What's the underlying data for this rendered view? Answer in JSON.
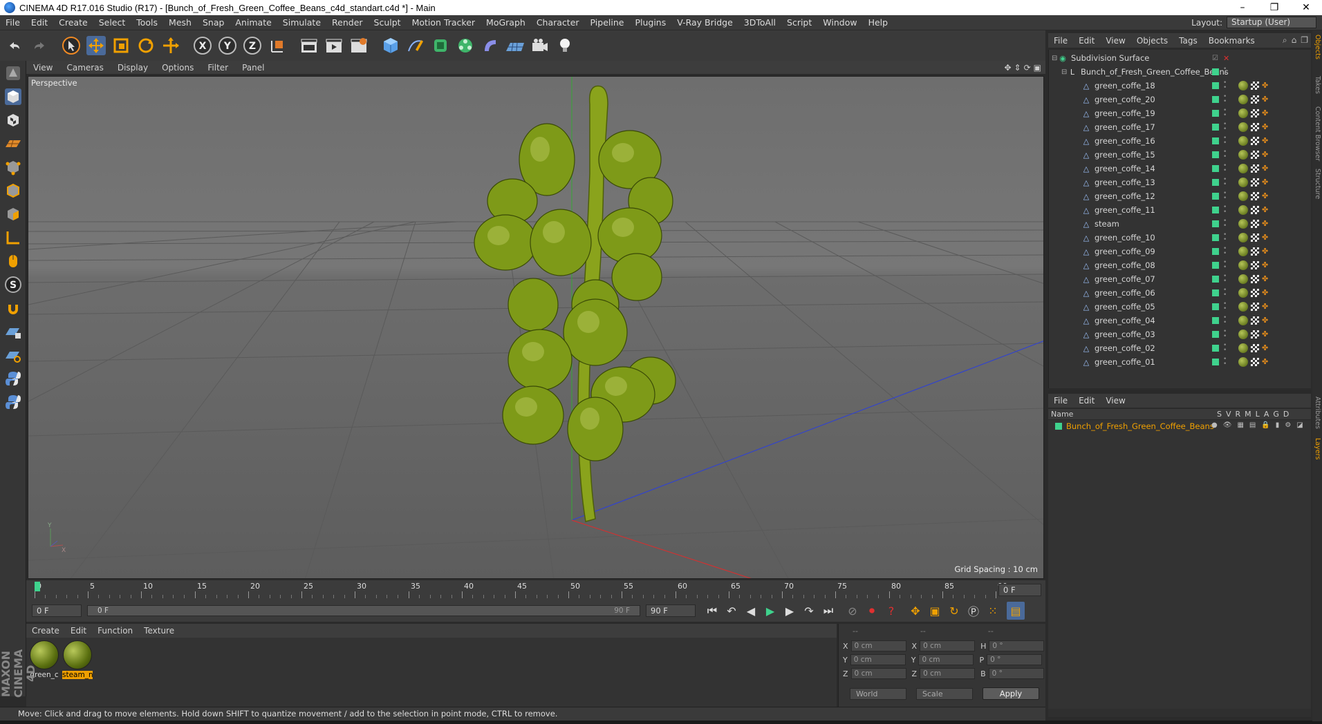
{
  "window": {
    "title": "CINEMA 4D R17.016 Studio (R17) - [Bunch_of_Fresh_Green_Coffee_Beans_c4d_standart.c4d *] - Main",
    "controls": [
      "–",
      "❐",
      "✕"
    ]
  },
  "menubar": {
    "items": [
      "File",
      "Edit",
      "Create",
      "Select",
      "Tools",
      "Mesh",
      "Snap",
      "Animate",
      "Simulate",
      "Render",
      "Sculpt",
      "Motion Tracker",
      "MoGraph",
      "Character",
      "Pipeline",
      "Plugins",
      "V-Ray Bridge",
      "3DToAll",
      "Script",
      "Window",
      "Help"
    ],
    "layout_label": "Layout:",
    "layout_value": "Startup (User)"
  },
  "viewport": {
    "menu": [
      "View",
      "Cameras",
      "Display",
      "Options",
      "Filter",
      "Panel"
    ],
    "label": "Perspective",
    "grid_spacing": "Grid Spacing : 10 cm"
  },
  "timeline": {
    "ticks": [
      "0",
      "5",
      "10",
      "15",
      "20",
      "25",
      "30",
      "35",
      "40",
      "45",
      "50",
      "55",
      "60",
      "65",
      "70",
      "75",
      "80",
      "85",
      "90"
    ],
    "current_frame": "0 F",
    "start_field": "0 F",
    "range_start": "0 F",
    "range_end": "90 F",
    "end_field": "90 F",
    "playhead_fraction": 0.0
  },
  "materials": {
    "menu": [
      "Create",
      "Edit",
      "Function",
      "Texture"
    ],
    "items": [
      {
        "name": "green_c",
        "selected": false
      },
      {
        "name": "steam_n",
        "selected": true
      }
    ]
  },
  "coords": {
    "header": [
      "--",
      "--",
      "--"
    ],
    "rows": [
      {
        "a": "X",
        "av": "0 cm",
        "b": "X",
        "bv": "0 cm",
        "c": "H",
        "cv": "0 °"
      },
      {
        "a": "Y",
        "av": "0 cm",
        "b": "Y",
        "bv": "0 cm",
        "c": "P",
        "cv": "0 °"
      },
      {
        "a": "Z",
        "av": "0 cm",
        "b": "Z",
        "bv": "0 cm",
        "c": "B",
        "cv": "0 °"
      }
    ],
    "space": "World",
    "mode": "Scale",
    "apply": "Apply"
  },
  "status": "Move: Click and drag to move elements. Hold down SHIFT to quantize movement / add to the selection in point mode, CTRL to remove.",
  "objects": {
    "menu": [
      "File",
      "Edit",
      "View",
      "Objects",
      "Tags",
      "Bookmarks"
    ],
    "root": "Subdivision Surface",
    "group": "Bunch_of_Fresh_Green_Coffee_Beans",
    "items": [
      "green_coffe_18",
      "green_coffe_20",
      "green_coffe_19",
      "green_coffe_17",
      "green_coffe_16",
      "green_coffe_15",
      "green_coffe_14",
      "green_coffe_13",
      "green_coffe_12",
      "green_coffe_11",
      "steam",
      "green_coffe_10",
      "green_coffe_09",
      "green_coffe_08",
      "green_coffe_07",
      "green_coffe_06",
      "green_coffe_05",
      "green_coffe_04",
      "green_coffe_03",
      "green_coffe_02",
      "green_coffe_01"
    ]
  },
  "layers": {
    "menu": [
      "File",
      "Edit",
      "View"
    ],
    "name_header": "Name",
    "columns": [
      "S",
      "V",
      "R",
      "M",
      "L",
      "A",
      "G",
      "D"
    ],
    "items": [
      "Bunch_of_Fresh_Green_Coffee_Beans"
    ]
  },
  "right_tabs": [
    "Objects",
    "Takes",
    "Content Browser",
    "Structure",
    "Attributes",
    "Layers"
  ],
  "colors": {
    "accent_orange": "#f0a000",
    "layer_green": "#3fd28d",
    "axis_blue": "#3344cc",
    "axis_red": "#cc3333",
    "axis_green": "#33aa33"
  }
}
